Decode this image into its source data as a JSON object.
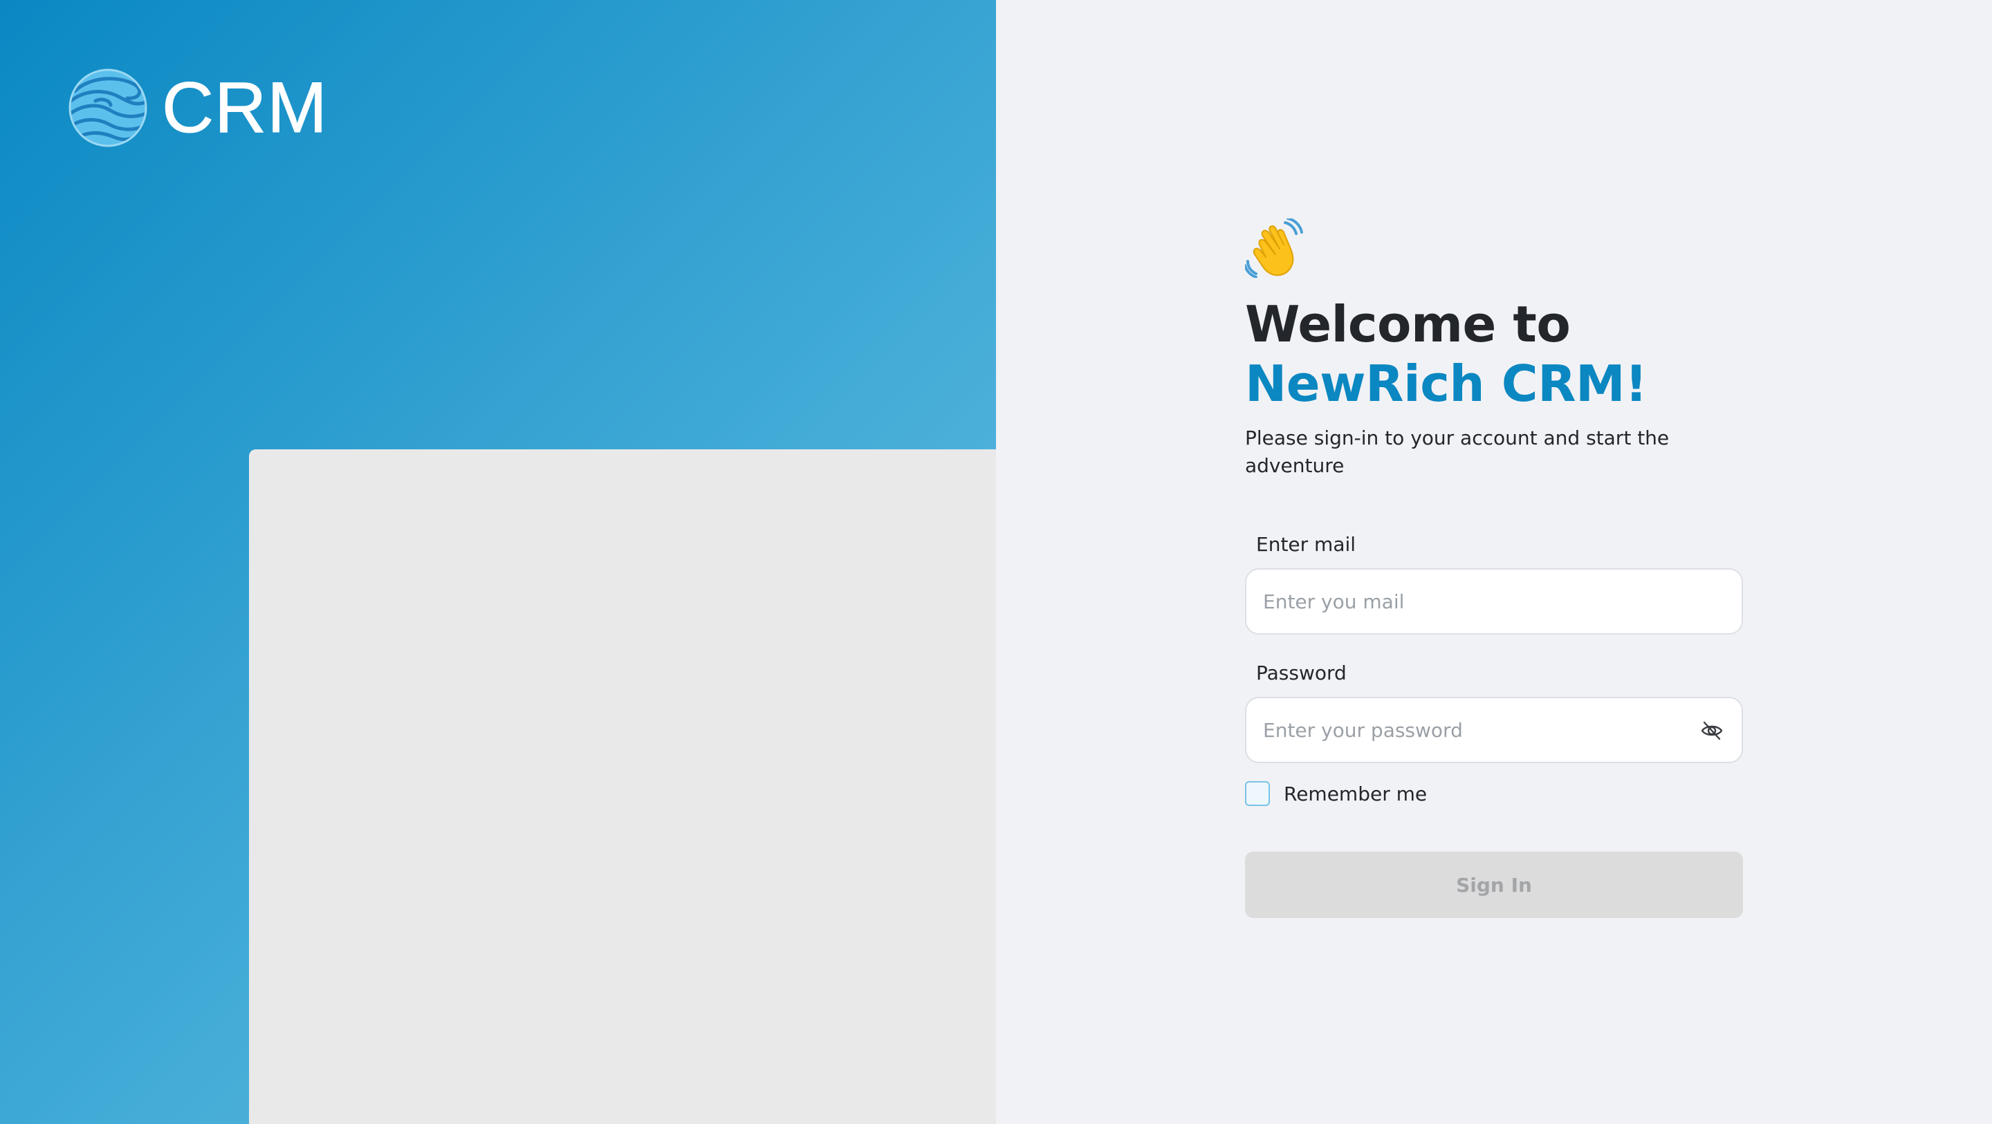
{
  "brand": {
    "logo_text": "CRM",
    "logo_icon": "swirl-globe-icon",
    "panel_gradient": [
      "#0a88c3",
      "#5cbadf"
    ]
  },
  "welcome": {
    "emoji_icon": "waving-hand-icon",
    "title_line1": "Welcome to",
    "title_line2": "NewRich CRM!",
    "subtitle": "Please sign-in to your account and start the adventure"
  },
  "form": {
    "email_label": "Enter mail",
    "email_placeholder": "Enter you mail",
    "email_value": "",
    "password_label": "Password",
    "password_placeholder": "Enter your password",
    "password_value": "",
    "password_visibility_icon": "eye-off-icon",
    "remember_label": "Remember me",
    "remember_checked": false,
    "submit_label": "Sign In",
    "submit_enabled": false
  },
  "colors": {
    "accent": "#0b87c1",
    "heading": "#23262b",
    "background": "#f1f2f5",
    "button_disabled": "#dcdcdd"
  }
}
